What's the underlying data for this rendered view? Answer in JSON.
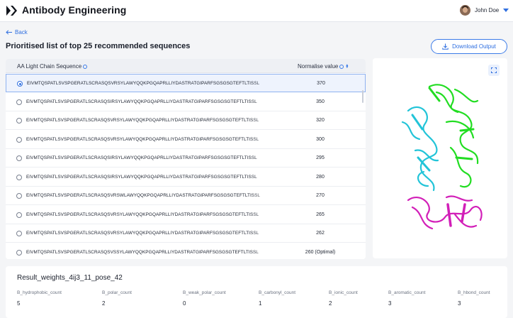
{
  "app": {
    "title": "Antibody Engineering",
    "logo_icon": "double-chevron-logo"
  },
  "user": {
    "name": "John Doe",
    "avatar_icon": "user-avatar",
    "menu_icon": "chevron-down-icon"
  },
  "nav": {
    "back_label": "Back",
    "back_icon": "arrow-left-icon"
  },
  "page": {
    "title": "Prioritised list of top 25 recommended sequences"
  },
  "actions": {
    "download_label": "Download Output",
    "download_icon": "download-icon"
  },
  "table": {
    "columns": {
      "sequence": "AA Light Chain Sequence",
      "value": "Normalise value"
    },
    "selected_index": 0,
    "rows": [
      {
        "sequence": "EIVMTQSPATLSVSPGERATLSCRASQSVRSYLAWYQQKPGQAPRLLIYDASTRATGIPARFSGSGSGTEFTLTISSL",
        "value": "370"
      },
      {
        "sequence": "EIVMTQSPATLSVSPGERATLSCRASQSIRSYLAWYQQKPGQAPRLLIYDASTRATGIPARFSGSGSGTEFTLTISSL",
        "value": "350"
      },
      {
        "sequence": "EIVMTQSPATLSVSPGERATLSCRASQSVRSYLAWYQQKPGQAPRLLIYDASTRATGIPARFSGSGSGTEFTLTISSL",
        "value": "320"
      },
      {
        "sequence": "EIVMTQSPATLSVSPGERATLSCRASQSVRSYLAWYQQKPGQAPRLLIYDASTRATGIPARFSGSGSGTEFTLTISSL",
        "value": "300"
      },
      {
        "sequence": "EIVMTQSPATLSVSPGERATLSCRASQSIRSYLAWYQQKPGQAPRLLIYDASTRATGIPARFSGSGSGTEFTLTISSL",
        "value": "295"
      },
      {
        "sequence": "EIVMTQSPATLSVSPGERATLSCRASQSIRSYLAWYQQKPGQAPRLLIYDASTRATGIPARFSGSGSGTEFTLTISSL",
        "value": "280"
      },
      {
        "sequence": "EIVMTQSPATLSVSPGERATLSCRASQSVRSWLAWYQQKPGQAPRLLIYDASTRATGIPARFSGSGSGTEFTLTISSL",
        "value": "270"
      },
      {
        "sequence": "EIVMTQSPATLSVSPGERATLSCRASQSVRSYLAWYQQKPGQAPRLLIYDASTRATGIPARFSGSGSGTEFTLTISSL",
        "value": "265"
      },
      {
        "sequence": "EIVMTQSPATLSVSPGERATLSCRASQSVRSYLAWYQQKPGQAPRLLIYDASTRATGIPARFSGSGSGTEFTLTISSL",
        "value": "262"
      },
      {
        "sequence": "EIVMTQSPATLSVSPGERATLSCRASQSVSSYLAWYQQKPGQAPRLLIYDASTRATGIPARFSGSGSGTEFTLTISSL",
        "value": "260 (Optimal)"
      }
    ]
  },
  "viewer": {
    "fullscreen_icon": "fullscreen-icon",
    "chain_colors": {
      "chain_a": "#22dd22",
      "chain_b": "#22c4d8",
      "chain_c": "#d21fb8"
    }
  },
  "results": {
    "title": "Result_weights_4ij3_11_pose_42",
    "metrics": [
      {
        "label": "B_hydrophobic_count",
        "value": "5"
      },
      {
        "label": "B_polar_count",
        "value": "2"
      },
      {
        "label": "B_weak_polar_count",
        "value": "0"
      },
      {
        "label": "B_carbonyl_count",
        "value": "1"
      },
      {
        "label": "B_ionic_count",
        "value": "2"
      },
      {
        "label": "B_aromatic_count",
        "value": "3"
      },
      {
        "label": "B_hbond_count",
        "value": "3"
      }
    ]
  },
  "colors": {
    "accent": "#2f6fe0",
    "background": "#f4f5f7"
  }
}
